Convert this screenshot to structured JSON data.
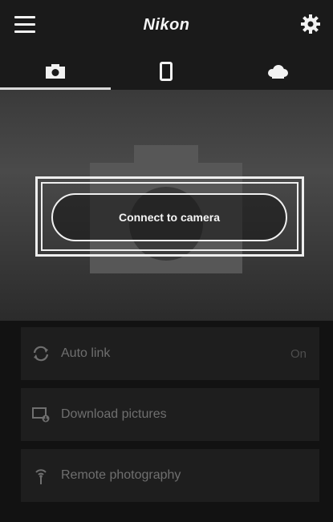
{
  "header": {
    "brand": "Nikon",
    "menu_icon": "hamburger-menu-icon",
    "settings_icon": "gear-icon"
  },
  "tabs": [
    {
      "icon": "camera-icon",
      "active": true
    },
    {
      "icon": "smartphone-icon",
      "active": false
    },
    {
      "icon": "cloud-icon",
      "active": false
    }
  ],
  "hero": {
    "connect_label": "Connect to camera"
  },
  "list": {
    "items": [
      {
        "icon": "sync-icon",
        "label": "Auto link",
        "value": "On"
      },
      {
        "icon": "download-pictures-icon",
        "label": "Download pictures"
      },
      {
        "icon": "remote-antenna-icon",
        "label": "Remote photography"
      }
    ]
  },
  "colors": {
    "background": "#121212",
    "bar": "#1a1a1a",
    "row": "#1e1e1e",
    "text_dim": "#6f6f6f",
    "foreground": "#f2f2f2"
  }
}
